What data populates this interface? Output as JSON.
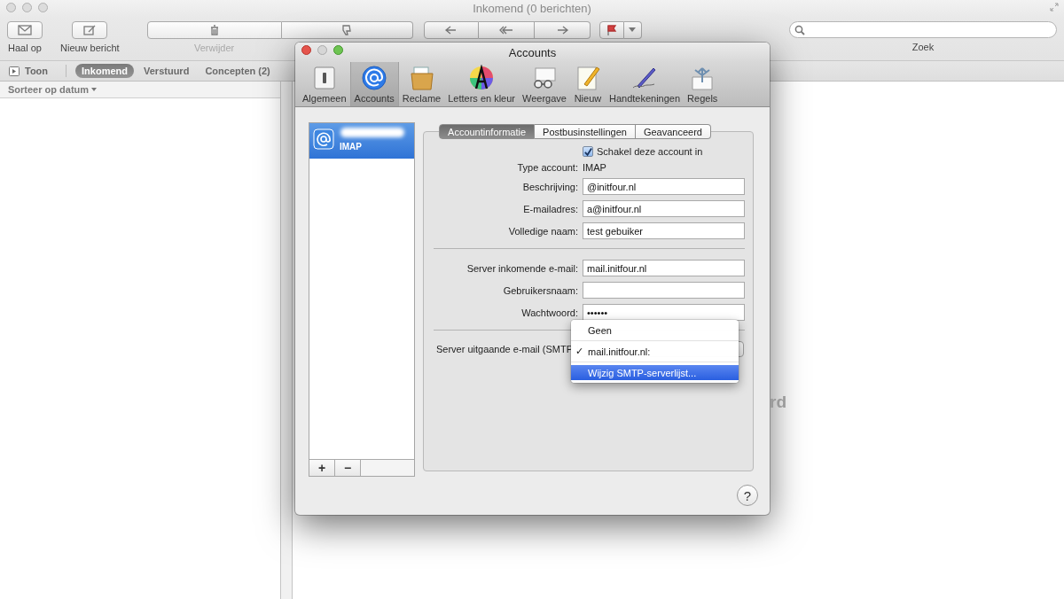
{
  "window": {
    "title": "Inkomend (0 berichten)"
  },
  "toolbar": [
    {
      "label": "Haal op"
    },
    {
      "label": "Nieuw bericht"
    },
    {
      "label": "Verwijder"
    }
  ],
  "search": {
    "label": "Zoek"
  },
  "filter_bar": {
    "toggle": "Toon",
    "mailboxes": [
      {
        "label": "Inkomend",
        "selected": true
      },
      {
        "label": "Verstuurd",
        "selected": false
      },
      {
        "label": "Concepten (2)",
        "selected": false
      }
    ]
  },
  "sort": {
    "label": "Sorteer op datum"
  },
  "message_pane": {
    "text": "rd"
  },
  "dialog": {
    "title": "Accounts",
    "toolbar": [
      {
        "label": "Algemeen",
        "selected": false
      },
      {
        "label": "Accounts",
        "selected": true
      },
      {
        "label": "Reclame",
        "selected": false
      },
      {
        "label": "Letters en kleur",
        "selected": false
      },
      {
        "label": "Weergave",
        "selected": false
      },
      {
        "label": "Nieuw",
        "selected": false
      },
      {
        "label": "Handtekeningen",
        "selected": false
      },
      {
        "label": "Regels",
        "selected": false
      }
    ],
    "accounts": [
      {
        "type": "IMAP",
        "selected": true
      }
    ],
    "list_buttons": [
      "+",
      "−"
    ],
    "tabs": [
      {
        "label": "Accountinformatie",
        "selected": true
      },
      {
        "label": "Postbusinstellingen",
        "selected": false
      },
      {
        "label": "Geavanceerd",
        "selected": false
      }
    ],
    "enable": {
      "label": "Schakel deze account in",
      "checked": true
    },
    "type_row": {
      "label": "Type account:",
      "value": "IMAP"
    },
    "account_fields": [
      {
        "label": "Beschrijving:",
        "value": "@initfour.nl"
      },
      {
        "label": "E-mailadres:",
        "value": "a@initfour.nl"
      },
      {
        "label": "Volledige naam:",
        "value": "test gebuiker"
      }
    ],
    "server_fields": [
      {
        "label": "Server inkomende e-mail:",
        "value": "mail.initfour.nl"
      },
      {
        "label": "Gebruikersnaam:"
      },
      {
        "label": "Wachtwoord:",
        "value": "••••••"
      }
    ],
    "smtp": {
      "label": "Server uitgaande e-mail (SMTP"
    },
    "menu": [
      {
        "kind": "item",
        "label": "Geen",
        "highlighted": false
      },
      {
        "kind": "separator"
      },
      {
        "kind": "item",
        "check": "✓",
        "label": "mail.initfour.nl:",
        "highlighted": false
      },
      {
        "kind": "separator"
      },
      {
        "kind": "item",
        "label": "Wijzig SMTP-serverlijst...",
        "highlighted": true
      }
    ],
    "help": "?"
  }
}
